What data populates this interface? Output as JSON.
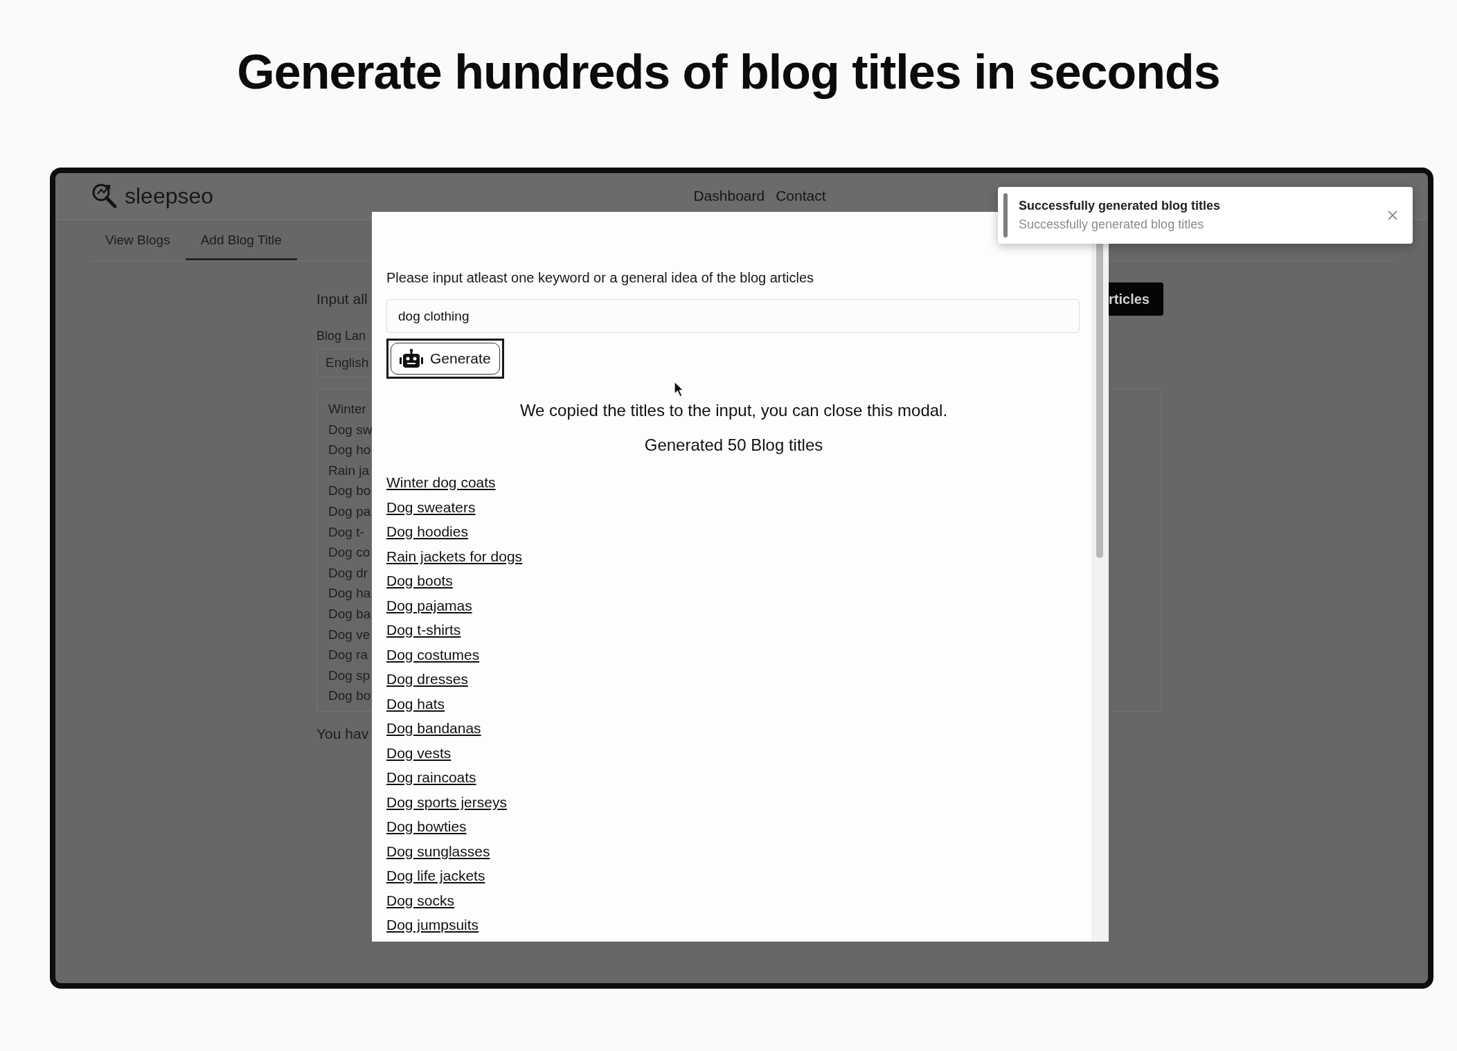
{
  "headline": "Generate hundreds of blog titles in seconds",
  "app": {
    "brand": "sleepseo",
    "nav": [
      {
        "label": "Dashboard"
      },
      {
        "label": "Contact"
      }
    ],
    "tabs": [
      {
        "label": "View Blogs",
        "selected": false
      },
      {
        "label": "Add Blog Title",
        "selected": true
      }
    ],
    "form": {
      "intro": "Input all",
      "action_button": "rticles",
      "language_label": "Blog Lan",
      "language_value": "English",
      "title_lines": [
        "Winter",
        "Dog sw",
        "Dog ho",
        "Rain ja",
        "Dog bo",
        "Dog pa",
        "Dog t-",
        "Dog co",
        "Dog dr",
        "Dog ha",
        "Dog ba",
        "Dog ve",
        "Dog ra",
        "Dog sp",
        "Dog bo"
      ],
      "footer": "You hav"
    }
  },
  "modal": {
    "prompt": "Please input atleast one keyword or a general idea of the blog articles",
    "input_value": "dog clothing",
    "generate_button": "Generate",
    "message": "We copied the titles to the input, you can close this modal.",
    "count_text": "Generated 50 Blog titles",
    "titles": [
      "Winter dog coats",
      "Dog sweaters",
      "Dog hoodies",
      "Rain jackets for dogs",
      "Dog boots",
      "Dog pajamas",
      "Dog t-shirts",
      "Dog costumes",
      "Dog dresses",
      "Dog hats",
      "Dog bandanas",
      "Dog vests",
      "Dog raincoats",
      "Dog sports jerseys",
      "Dog bowties",
      "Dog sunglasses",
      "Dog life jackets",
      "Dog socks",
      "Dog jumpsuits"
    ]
  },
  "toast": {
    "title": "Successfully generated blog titles",
    "body": "Successfully generated blog titles"
  }
}
